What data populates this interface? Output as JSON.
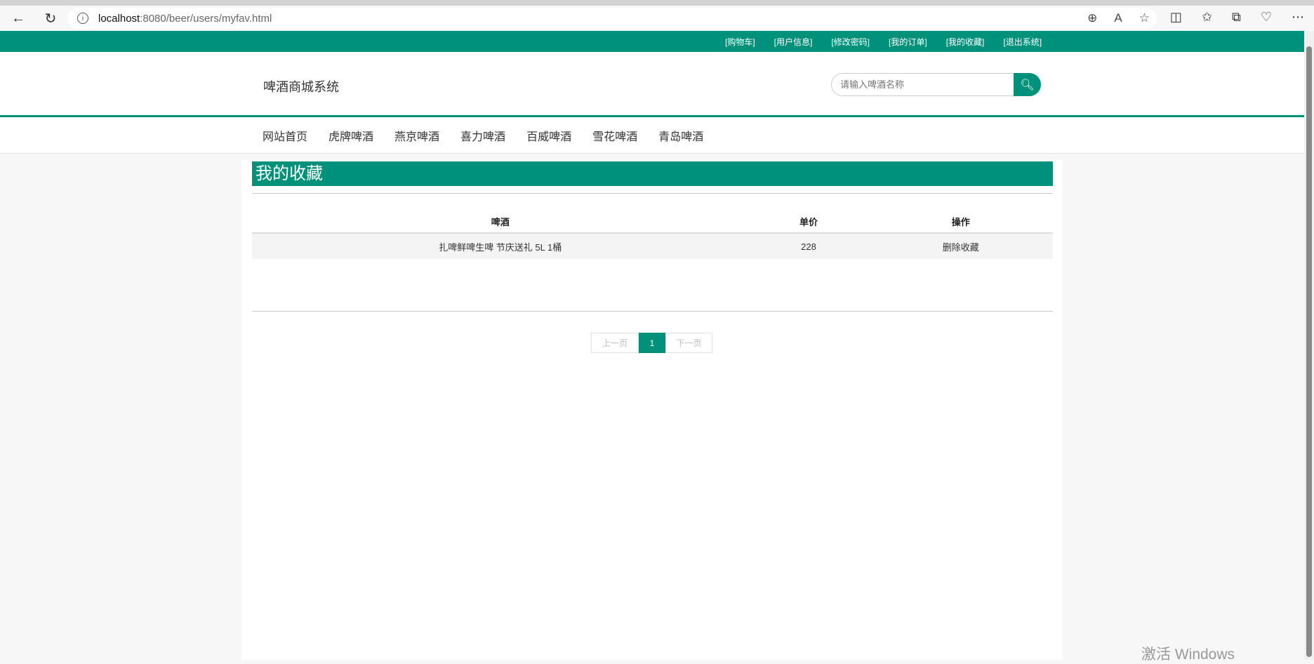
{
  "browser": {
    "url_host": "localhost",
    "url_path": ":8080/beer/users/myfav.html"
  },
  "topbar": {
    "links": [
      "[购物车]",
      "[用户信息]",
      "[修改密码]",
      "[我的订单]",
      "[我的收藏]",
      "[退出系统]"
    ]
  },
  "header": {
    "logo": "啤酒商城系统",
    "search_placeholder": "请输入啤酒名称"
  },
  "nav": [
    "网站首页",
    "虎牌啤酒",
    "燕京啤酒",
    "喜力啤酒",
    "百威啤酒",
    "雪花啤酒",
    "青岛啤酒"
  ],
  "main": {
    "title": "我的收藏",
    "columns": [
      "啤酒",
      "单价",
      "操作"
    ],
    "rows": [
      {
        "name": "扎啤鲜啤生啤 节庆送礼 5L 1桶",
        "price": "228",
        "action": "删除收藏"
      }
    ],
    "pager": {
      "prev": "上一页",
      "current": "1",
      "next": "下一页"
    }
  },
  "watermark": "激活 Windows",
  "colors": {
    "accent": "#00917b"
  }
}
